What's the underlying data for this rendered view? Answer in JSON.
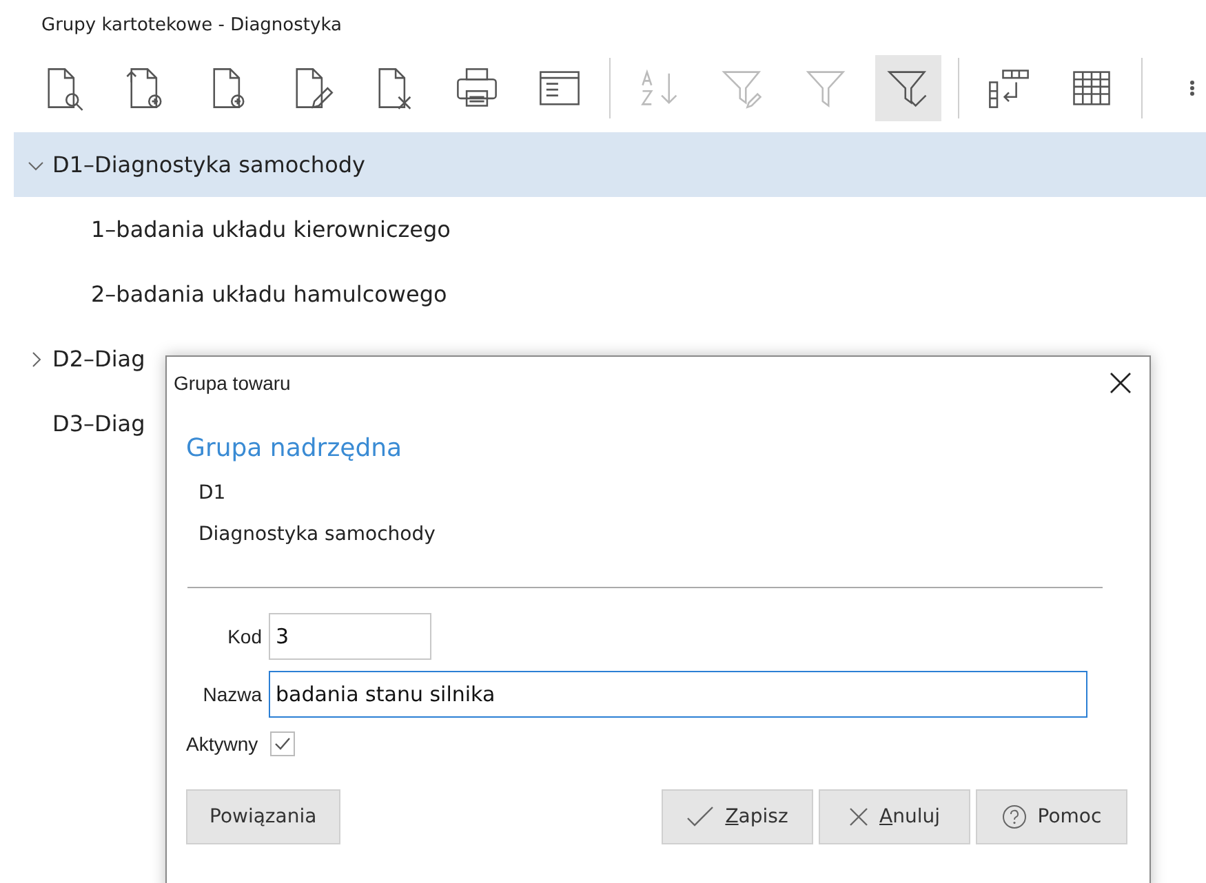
{
  "window": {
    "title": "Grupy kartotekowe - Diagnostyka"
  },
  "toolbar": [
    {
      "kind": "preview",
      "disabled": false,
      "selected": false
    },
    {
      "kind": "import",
      "disabled": false,
      "selected": false
    },
    {
      "kind": "add",
      "disabled": false,
      "selected": false
    },
    {
      "kind": "edit",
      "disabled": false,
      "selected": false
    },
    {
      "kind": "delete",
      "disabled": false,
      "selected": false
    },
    {
      "kind": "print",
      "disabled": false,
      "selected": false
    },
    {
      "kind": "form",
      "disabled": false,
      "selected": false
    },
    {
      "kind": "separator"
    },
    {
      "kind": "sort",
      "disabled": true,
      "selected": false
    },
    {
      "kind": "filter-edit",
      "disabled": true,
      "selected": false
    },
    {
      "kind": "filter",
      "disabled": true,
      "selected": false
    },
    {
      "kind": "filter-check",
      "disabled": false,
      "selected": true
    },
    {
      "kind": "separator"
    },
    {
      "kind": "columns",
      "disabled": false,
      "selected": false
    },
    {
      "kind": "grid",
      "disabled": false,
      "selected": false
    },
    {
      "kind": "separator"
    },
    {
      "kind": "more",
      "disabled": false,
      "selected": false
    }
  ],
  "tree": [
    {
      "label": "D1–Diagnostyka samochody",
      "expanded": true,
      "selected": true,
      "children": [
        {
          "label": "1–badania układu kierowniczego",
          "selected": false
        },
        {
          "label": "2–badania układu hamulcowego",
          "selected": false
        }
      ]
    },
    {
      "label": "D2–Diag",
      "expanded": false,
      "selected": false
    },
    {
      "label": "D3–Diag",
      "selected": false
    }
  ],
  "dialog": {
    "title": "Grupa towaru",
    "section": "Grupa nadrzędna",
    "parent_code": "D1",
    "parent_name": "Diagnostyka samochody",
    "code": {
      "label": "Kod",
      "value": "3"
    },
    "name": {
      "label": "Nazwa",
      "value": "badania stanu silnika",
      "focused": true
    },
    "active": {
      "label": "Aktywny",
      "checked": true
    },
    "buttons": [
      {
        "kind": "links",
        "label": "Powiązania"
      },
      {
        "kind": "save",
        "label": "Zapisz"
      },
      {
        "kind": "cancel",
        "label": "Anuluj"
      },
      {
        "kind": "help",
        "label": "Pomoc"
      }
    ]
  }
}
